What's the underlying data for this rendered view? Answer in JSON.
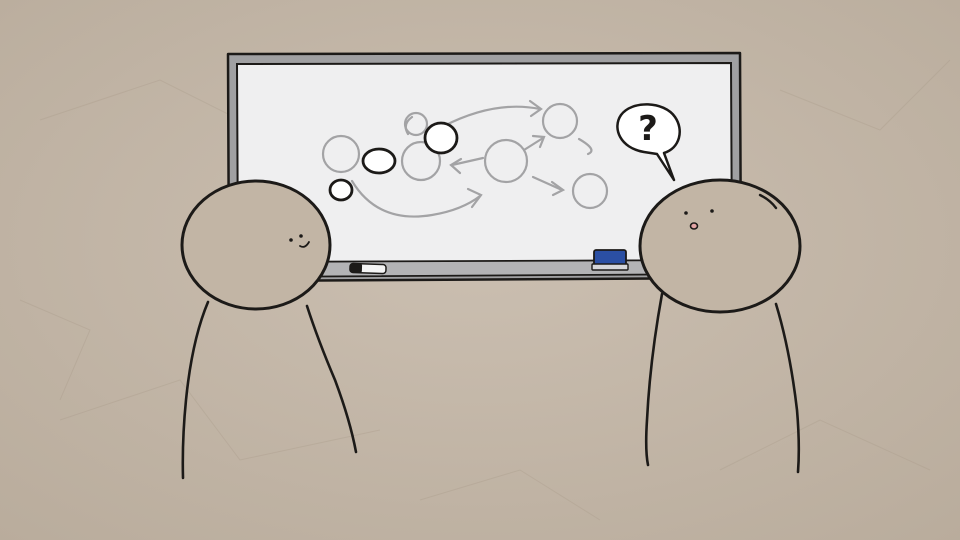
{
  "scene": {
    "speech_bubble": {
      "text": "?"
    },
    "colors": {
      "paper": "#c4b8aa",
      "paper_shadow": "#b5a898",
      "ink": "#1c1a18",
      "whiteboard_surface": "#efeff0",
      "whiteboard_frame": "#9c9c9e",
      "diagram_gray": "#a3a3a5",
      "highlight_white": "#ffffff",
      "character_fill": "#c2b5a5",
      "eraser_blue": "#2b4fa3",
      "marker_white": "#f4f4f4",
      "mouth_pink": "#e3a4a4"
    },
    "icons": {
      "left_character": "smiling-stick-figure",
      "right_character": "surprised-stick-figure",
      "whiteboard": "whiteboard",
      "speech_bubble": "question-speech-bubble",
      "marker": "whiteboard-marker",
      "eraser": "whiteboard-eraser"
    }
  }
}
